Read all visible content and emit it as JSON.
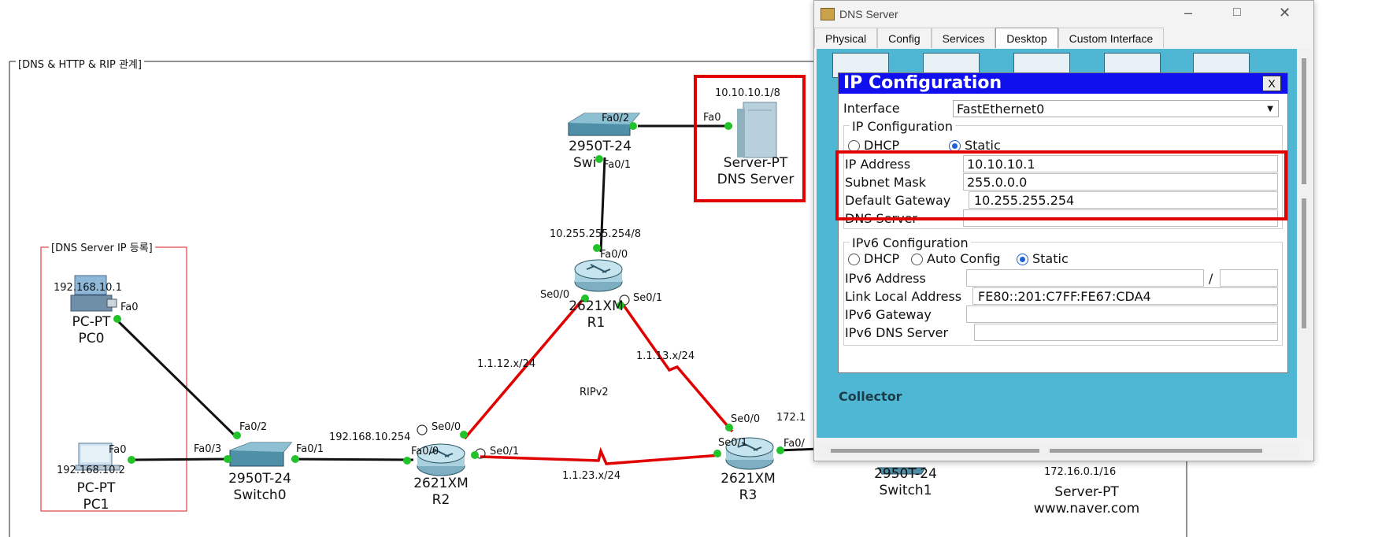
{
  "topology": {
    "frame_label": "[DNS & HTTP & RIP 관계]",
    "subframe_label": "[DNS Server IP 등록]",
    "dns_server_ip": "10.10.10.1/8",
    "pc0": {
      "ip": "192.168.10.1",
      "model": "PC-PT",
      "name": "PC0",
      "port": "Fa0"
    },
    "pc1": {
      "ip": "192.168.10.2",
      "model": "PC-PT",
      "name": "PC1",
      "port": "Fa0"
    },
    "switch0": {
      "model": "2950T-24",
      "name": "Switch0",
      "ports": [
        "Fa0/2",
        "Fa0/3",
        "Fa0/1"
      ]
    },
    "switch_top": {
      "model": "2950T-24",
      "name": "Swi",
      "ports": [
        "Fa0/2",
        "Fa0/1"
      ]
    },
    "server_dns": {
      "model": "Server-PT",
      "name": "DNS Server",
      "port": "Fa0"
    },
    "r1": {
      "model": "2621XM",
      "name": "R1",
      "net": "10.255.255.254/8",
      "ports": [
        "Fa0/0",
        "Se0/0",
        "Se0/1"
      ]
    },
    "r2": {
      "model": "2621XM",
      "name": "R2",
      "net": "192.168.10.254",
      "ports": [
        "Fa0/0",
        "Se0/0",
        "Se0/1"
      ]
    },
    "r3": {
      "model": "2621XM",
      "name": "R3",
      "ports": [
        "Se0/0",
        "Se0/1",
        "Fa0/"
      ]
    },
    "links": {
      "r1r2": "1.1.12.x/24",
      "r1r3": "1.1.13.x/24",
      "r2r3": "1.1.23.x/24",
      "protocol": "RIPv2"
    },
    "switch1": {
      "model": "2950T-24",
      "name": "Switch1"
    },
    "server_naver": {
      "ip": "172.16.0.1/16",
      "model": "Server-PT",
      "name": "www.naver.com"
    },
    "r3_partial_ip": "172.1"
  },
  "window": {
    "title": "DNS Server",
    "tabs": [
      "Physical",
      "Config",
      "Services",
      "Desktop",
      "Custom Interface"
    ],
    "active_tab": "Desktop",
    "background_text": "Collector"
  },
  "ipconfig": {
    "title": "IP Configuration",
    "close_label": "X",
    "interface_label": "Interface",
    "interface_value": "FastEthernet0",
    "ipv4_section": "IP Configuration",
    "dhcp": "DHCP",
    "static": "Static",
    "ip_label": "IP Address",
    "ip_value": "10.10.10.1",
    "mask_label": "Subnet Mask",
    "mask_value": "255.0.0.0",
    "gw_label": "Default Gateway",
    "gw_value": "10.255.255.254",
    "dns_label": "DNS Server",
    "dns_value": "",
    "ipv6_section": "IPv6 Configuration",
    "auto_config": "Auto Config",
    "ipv6_addr_label": "IPv6 Address",
    "ipv6_slash": "/",
    "link_local_label": "Link Local Address",
    "link_local_value": "FE80::201:C7FF:FE67:CDA4",
    "ipv6_gw_label": "IPv6 Gateway",
    "ipv6_dns_label": "IPv6 DNS Server"
  },
  "colors": {
    "highlight": "#e00000",
    "link": "#e00000",
    "title_bar": "#1010ee",
    "desktop_bg": "#4fb7d3"
  }
}
